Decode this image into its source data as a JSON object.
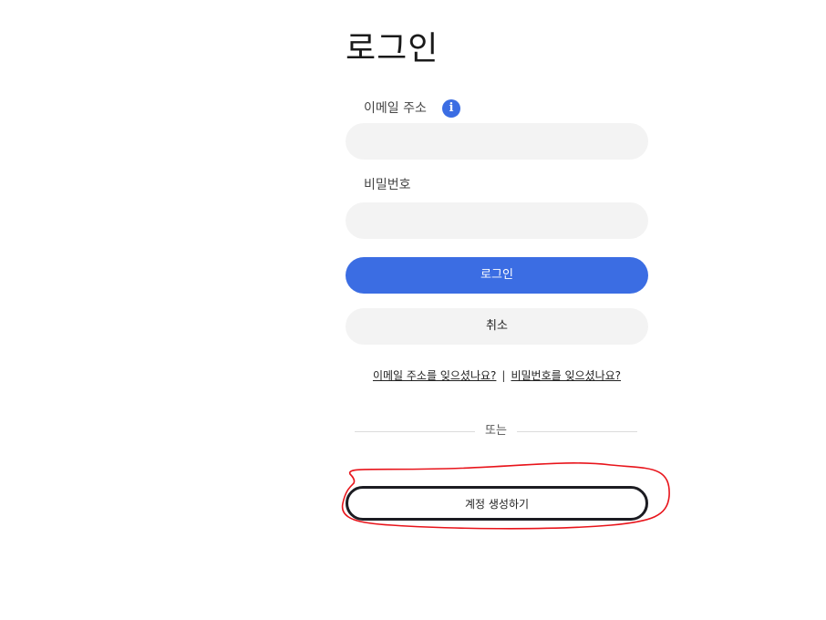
{
  "login": {
    "title": "로그인",
    "email_label": "이메일 주소",
    "email_value": "",
    "password_label": "비밀번호",
    "password_value": "",
    "login_button": "로그인",
    "cancel_button": "취소",
    "forgot_email_link": "이메일 주소를 잊으셨나요?",
    "link_separator": "|",
    "forgot_password_link": "비밀번호를 잊으셨나요?",
    "divider_text": "또는",
    "create_account_button": "계정 생성하기"
  },
  "icons": {
    "info": "info-icon",
    "info_glyph": "i"
  },
  "colors": {
    "primary": "#3b6de3",
    "input_bg": "#f3f3f3",
    "annotation": "#e8141b"
  }
}
